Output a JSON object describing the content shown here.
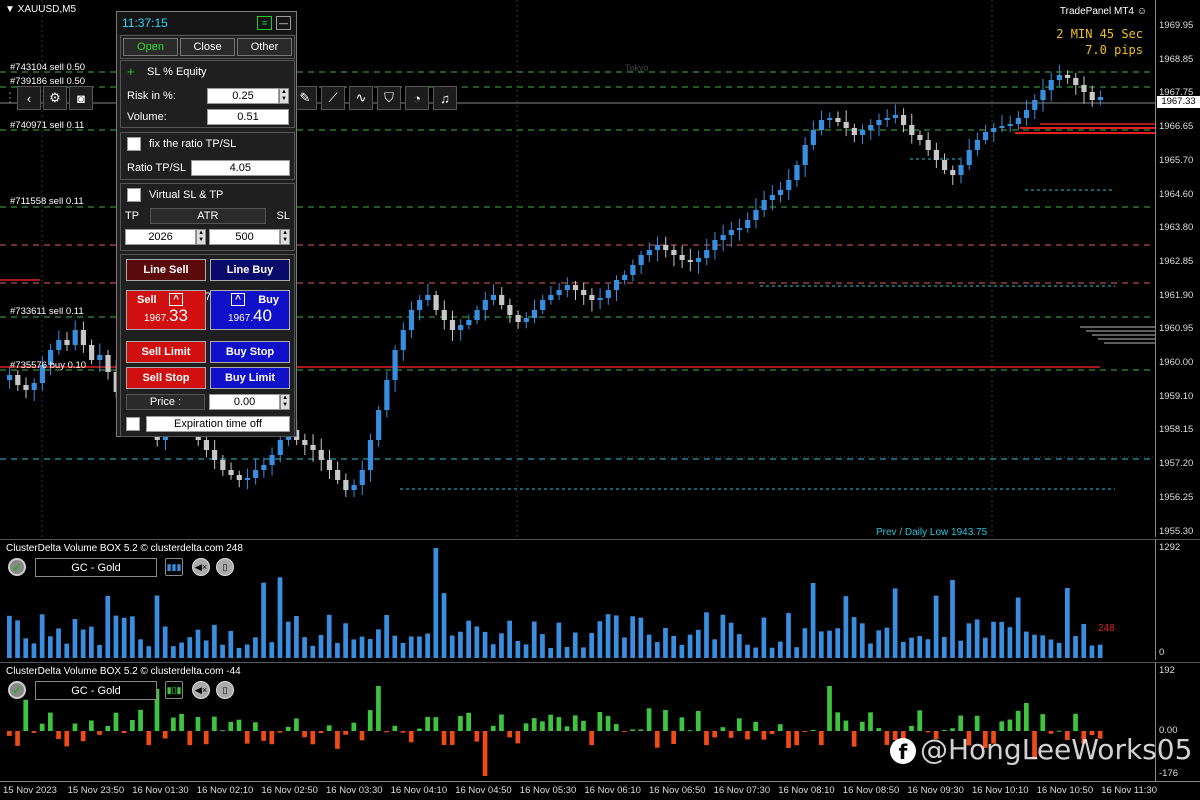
{
  "chart": {
    "symbol": "XAUUSD,M5",
    "panel_name": "TradePanel MT4",
    "timer": "2 MIN 45 Sec",
    "pips": "7.0 pips",
    "session_label": "Tokyo",
    "prev_daily_low": "Prev / Daily Low 1943.75",
    "current_price": "1967.33",
    "price_ticks": [
      "1969.95",
      "1968.85",
      "1967.75",
      "1966.65",
      "1965.70",
      "1964.60",
      "1963.80",
      "1962.85",
      "1961.90",
      "1960.95",
      "1960.00",
      "1959.10",
      "1958.15",
      "1957.20",
      "1956.25",
      "1955.30"
    ],
    "order_labels": [
      {
        "text": "#743104 sell 0.50"
      },
      {
        "text": "#739186 sell 0.50"
      },
      {
        "text": "#740971 sell 0.11"
      },
      {
        "text": "#711558 sell 0.11"
      },
      {
        "text": "#733611 sell 0.11"
      },
      {
        "text": "#735576 buy 0.10"
      }
    ],
    "colors": {
      "bull": "#3a8ee0",
      "bear": "#c8c8c8",
      "green_line": "#3fb43f",
      "red_line": "#e02020",
      "cyan": "#2bc0d8"
    }
  },
  "toolbar": {
    "icons": [
      "grip-icon",
      "back-icon",
      "gear-icon",
      "camera-icon",
      "draw-icon",
      "trend-icon",
      "line-chart-icon",
      "shield-icon",
      "pie-icon",
      "bell-icon"
    ]
  },
  "trade_panel": {
    "time": "11:37:15",
    "tabs": [
      "Open",
      "Close",
      "Other"
    ],
    "sl_equity_label": "SL % Equity",
    "risk_label": "Risk in %:",
    "risk_value": "0.25",
    "volume_label": "Volume:",
    "volume_value": "0.51",
    "fix_ratio_label": "fix the ratio TP/SL",
    "ratio_label": "Ratio TP/SL",
    "ratio_value": "4.05",
    "virtual_label": "Virtual SL & TP",
    "tp_label": "TP",
    "atr_label": "ATR",
    "sl_label": "SL",
    "tp_value": "2026",
    "sl_value": "500",
    "line_sell": "Line Sell",
    "line_buy": "Line Buy",
    "sell_label": "Sell",
    "buy_label": "Buy",
    "spread": "7",
    "sell_price_main": "1967.",
    "sell_price_big": "33",
    "buy_price_main": "1967.",
    "buy_price_big": "40",
    "sell_limit": "Sell Limit",
    "buy_stop": "Buy Stop",
    "sell_stop": "Sell Stop",
    "buy_limit": "Buy Limit",
    "price_label": "Price :",
    "price_value": "0.00",
    "expiration_label": "Expiration time off"
  },
  "volume_pane": {
    "title": "ClusterDelta Volume BOX 5.2 © clusterdelta.com 248",
    "instrument": "GC - Gold",
    "axis_max": "1292",
    "axis_min": "0",
    "last_value": "248"
  },
  "delta_pane": {
    "title": "ClusterDelta Volume BOX 5.2 © clusterdelta.com -44",
    "instrument": "GC - Gold",
    "axis_max": "192",
    "axis_zero": "0.00",
    "axis_min": "-176"
  },
  "time_axis": [
    "15 Nov 2023",
    "15 Nov 23:50",
    "16 Nov 01:30",
    "16 Nov 02:10",
    "16 Nov 02:50",
    "16 Nov 03:30",
    "16 Nov 04:10",
    "16 Nov 04:50",
    "16 Nov 05:30",
    "16 Nov 06:10",
    "16 Nov 06:50",
    "16 Nov 07:30",
    "16 Nov 08:10",
    "16 Nov 08:50",
    "16 Nov 09:30",
    "16 Nov 10:10",
    "16 Nov 10:50",
    "16 Nov 11:30"
  ],
  "watermark": "@HongLeeWorks05"
}
